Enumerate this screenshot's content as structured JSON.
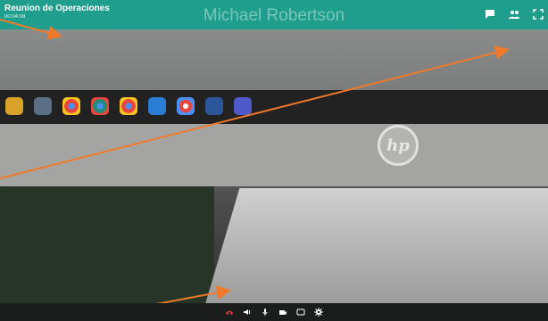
{
  "header": {
    "meeting_title": "Reunion de Operaciones",
    "timer": "00:04:08",
    "participant_name": "Michael Robertson",
    "icons": [
      "chat-icon",
      "participants-icon",
      "fullscreen-icon"
    ]
  },
  "colors": {
    "header_bg": "#1f9e8d",
    "hangup": "#e53935",
    "arrow": "#f07a2a"
  },
  "taskbar_apps": [
    "folder-icon",
    "app-icon",
    "chrome-icon",
    "chrome-icon",
    "chrome-icon",
    "edge-icon",
    "chrome-icon",
    "word-icon",
    "teams-icon"
  ],
  "brand": {
    "logo_text": "hp"
  },
  "toolbar": {
    "icons": [
      "hangup-icon",
      "volume-icon",
      "microphone-icon",
      "camera-icon",
      "screen-share-icon",
      "settings-icon"
    ]
  }
}
